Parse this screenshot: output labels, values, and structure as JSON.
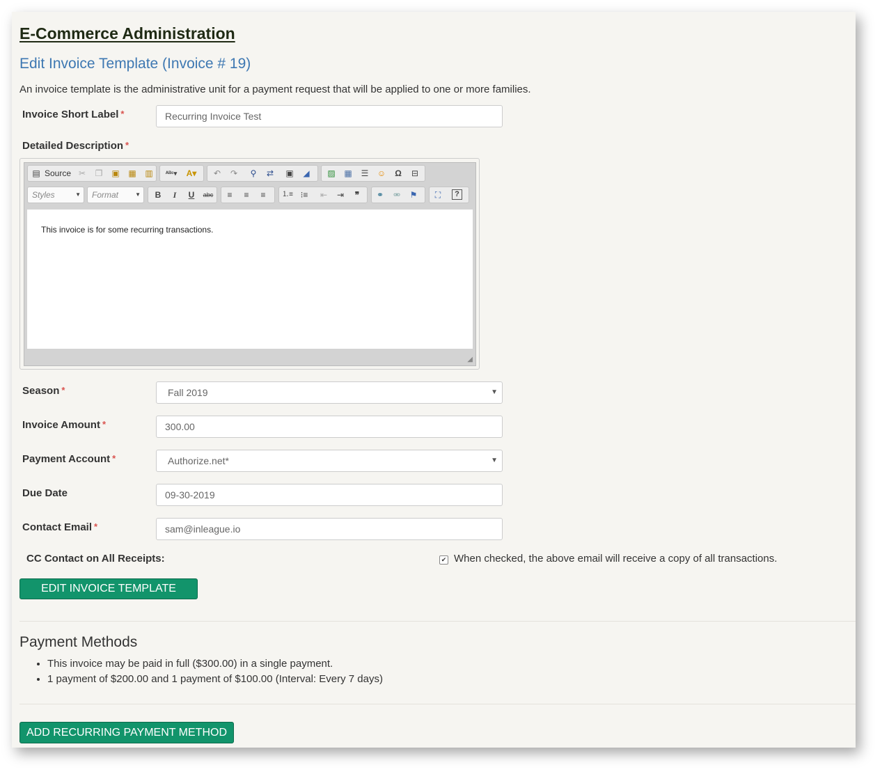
{
  "header": {
    "title": "E-Commerce Administration",
    "subtitle": "Edit Invoice Template (Invoice # 19)",
    "intro": "An invoice template is the administrative unit for a payment request that will be applied to one or more families."
  },
  "form": {
    "short_label": {
      "label": "Invoice Short Label",
      "value": "Recurring Invoice Test"
    },
    "description": {
      "label": "Detailed Description",
      "content": "This invoice is for some recurring transactions."
    },
    "season": {
      "label": "Season",
      "value": "Fall 2019"
    },
    "amount": {
      "label": "Invoice Amount",
      "value": "300.00"
    },
    "payment_account": {
      "label": "Payment Account",
      "value": "Authorize.net*"
    },
    "due_date": {
      "label": "Due Date",
      "value": "09-30-2019"
    },
    "contact_email": {
      "label": "Contact Email",
      "value": "sam@inleague.io"
    },
    "cc": {
      "label": "CC Contact on All Receipts:",
      "hint": "When checked, the above email will receive a copy of all transactions.",
      "checked": true
    },
    "required_marker": "*"
  },
  "editor": {
    "source_label": "Source",
    "styles_label": "Styles",
    "format_label": "Format"
  },
  "buttons": {
    "edit": "EDIT INVOICE TEMPLATE",
    "add_recurring": "ADD RECURRING PAYMENT METHOD"
  },
  "payment_methods": {
    "title": "Payment Methods",
    "items": [
      "This invoice may be paid in full ($300.00) in a single payment.",
      "1 payment of $200.00 and 1 payment of $100.00 (Interval: Every 7 days)"
    ]
  },
  "colors": {
    "accent": "#12946b",
    "heading_blue": "#3e78b2",
    "required": "#d9534f"
  }
}
